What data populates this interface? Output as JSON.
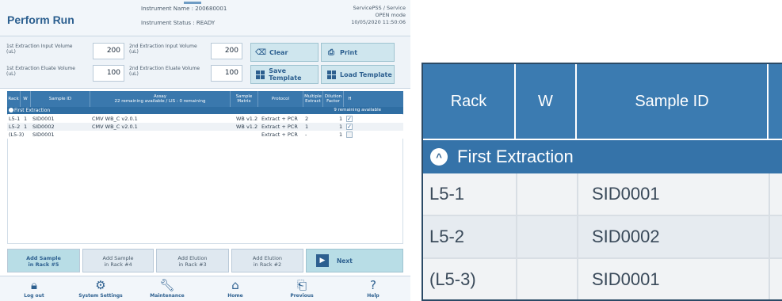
{
  "header": {
    "title": "Perform Run",
    "instrument_name": "Instrument Name : 200680001",
    "instrument_status": "Instrument Status : READY",
    "user": "ServicePSS / Service",
    "mode": "OPEN mode",
    "datetime": "10/05/2020 11:50:06"
  },
  "volumes": {
    "ext1_input_label_1": "1st Extraction Input Volume",
    "ext1_input_label_2": "(uL)",
    "ext1_input_value": "200",
    "ext2_input_label_1": "2nd Extraction Input Volume",
    "ext2_input_label_2": "(uL)",
    "ext2_input_value": "200",
    "ext1_eluate_label_1": "1st Extraction Eluate Volume",
    "ext1_eluate_label_2": "(uL)",
    "ext1_eluate_value": "100",
    "ext2_eluate_label_1": "2nd Extraction Eluate Volume",
    "ext2_eluate_label_2": "(uL)",
    "ext2_eluate_value": "100"
  },
  "tools": {
    "clear": "Clear",
    "print": "Print",
    "save_template": "Save Template",
    "load_template": "Load Template"
  },
  "table": {
    "headers": {
      "rack": "Rack",
      "w": "W",
      "sample_id": "Sample ID",
      "assay_1": "Assay",
      "assay_2": "22 remaining available / LIS : 0 remaining",
      "matrix_1": "Sample",
      "matrix_2": "Matrix",
      "protocol": "Protocol",
      "multi_1": "Multiple",
      "multi_2": "Extract",
      "dilution_1": "Dilution",
      "dilution_2": "Factor",
      "h": "H"
    },
    "group_label": "First Extraction",
    "group_remaining": "9 remaining available",
    "rows": [
      {
        "rack": "L5-1",
        "w": "1",
        "sample_id": "SID0001",
        "assay": "CMV WB_C v2.0.1",
        "matrix": "WB v1.2",
        "protocol": "Extract + PCR",
        "multi": "2",
        "dilution": "1",
        "checked": "✓"
      },
      {
        "rack": "L5-2",
        "w": "1",
        "sample_id": "SID0002",
        "assay": "CMV WB_C v2.0.1",
        "matrix": "WB v1.2",
        "protocol": "Extract + PCR",
        "multi": "1",
        "dilution": "1",
        "checked": "✓"
      },
      {
        "rack": "(L5-3)",
        "w": "",
        "sample_id": "SID0001",
        "assay": "",
        "matrix": "",
        "protocol": "Extract + PCR",
        "multi": "-",
        "dilution": "1",
        "checked": ""
      }
    ]
  },
  "buttons": {
    "add_sample_5_1": "Add Sample",
    "add_sample_5_2": "in Rack #5",
    "add_sample_4_1": "Add Sample",
    "add_sample_4_2": "in Rack #4",
    "add_elution_3_1": "Add Elution",
    "add_elution_3_2": "in Rack #3",
    "add_elution_2_1": "Add Elution",
    "add_elution_2_2": "in Rack #2",
    "next": "Next"
  },
  "nav": {
    "logout": "Log out",
    "system_settings": "System Settings",
    "maintenance": "Maintenance",
    "home": "Home",
    "previous": "Previous",
    "help": "Help"
  },
  "zoom": {
    "rack": "Rack",
    "w": "W",
    "sample_id": "Sample ID",
    "group": "First Extraction",
    "rows": [
      {
        "rack": "L5-1",
        "sample_id": "SID0001"
      },
      {
        "rack": "L5-2",
        "sample_id": "SID0002"
      },
      {
        "rack": "(L5-3)",
        "sample_id": "SID0001"
      }
    ]
  },
  "colors": {
    "accent": "#2c5f8f",
    "table_header": "#3a78ad",
    "button_active": "#b8dde6"
  }
}
